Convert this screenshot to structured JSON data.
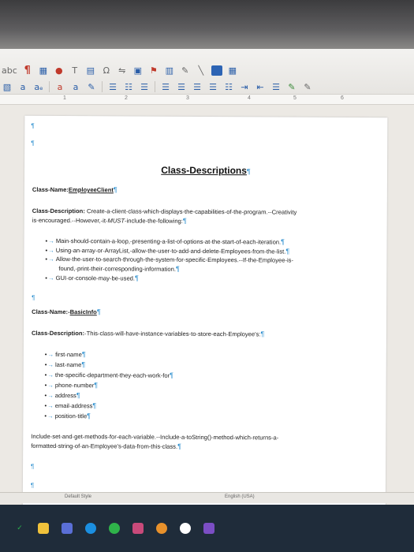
{
  "toolbar": {
    "row1": [
      "abc-label",
      "pilcrow-icon",
      "table-icon",
      "color-icon",
      "text-box-icon",
      "special-char-icon",
      "hyperlink-icon",
      "comment-icon",
      "image-icon",
      "chart-icon",
      "draw-line-icon",
      "shapes-icon",
      "grid-icon"
    ],
    "abc_label": "abc",
    "omega_label": "Ω"
  },
  "ruler": {
    "numbers": [
      "1",
      "2",
      "3",
      "4",
      "5",
      "6"
    ]
  },
  "document": {
    "title": "Class-Descriptions",
    "section1": {
      "class_name_label": "Class-Name:",
      "class_name_value": "EmployeeClient",
      "desc_label": "Class-Description:",
      "desc_line1": "Create-a-client-class-which-displays-the-capabilities-of-the-program.--Creativity",
      "desc_line2a": "is-encouraged.--However,-it-",
      "desc_must": "MUST",
      "desc_line2b": "-include-the-following:",
      "bullets": [
        "Main-should-contain-a-loop,-presenting-a-list-of-options-at-the-start-of-each-iteration.",
        "Using-an-array-or-ArrayList,-allow-the-user-to-add-and-delete-Employees-from-the-list.",
        "Allow-the-user-to-search-through-the-system-for-specific-Employees.--If-the-Employee-is-",
        "found,-print-their-corresponding-information.",
        "GUI-or-console-may-be-used."
      ]
    },
    "section2": {
      "class_name_label": "Class-Name:-",
      "class_name_value": "BasicInfo",
      "desc_label": "Class-Description:",
      "desc_text": "-This-class-will-have-instance-variables-to-store-each-Employee's:",
      "bullets": [
        "first-name",
        "last-name",
        "the-specific-department-they-each-work-for",
        "phone-number",
        "address",
        "email-address",
        "position-title"
      ],
      "footer_line1": "Include-set-and-get-methods-for-each-variable.--Include-a-toString()-method-which-returns-a-",
      "footer_line2": "formatted-string-of-an-Employee's-data-from-this-class."
    }
  },
  "statusbar": {
    "style": "Default Style",
    "language": "English (USA)"
  },
  "colors": {
    "pilcrow": "#2c8fcf",
    "taskbar": "#1f2c3a"
  }
}
